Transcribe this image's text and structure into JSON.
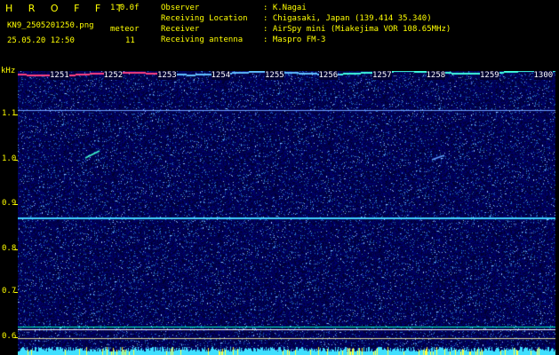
{
  "header": {
    "app_name": "H R O F F T",
    "version": "1.0.0f",
    "filename": "KN9_2505201250.png",
    "datetime": "25.05.20 12:50",
    "mode": "meteor",
    "count": "11",
    "observer_label": "Observer",
    "observer_value": ": K.Nagai",
    "location_label": "Receiving Location",
    "location_value": ": Chigasaki, Japan (139.414 35.340)",
    "receiver_label": "Receiver",
    "receiver_value": ": AirSpy mini (Miakejima VOR 108.65MHz)",
    "antenna_label": "Receiving antenna",
    "antenna_value": ": Maspro FM-3"
  },
  "axes": {
    "y_unit": "kHz",
    "y_ticks": [
      "1.1",
      "1.0",
      "0.9",
      "0.8",
      "0.7",
      "0.6"
    ],
    "x_ticks": [
      "1251",
      "1252",
      "1253",
      "1254",
      "1255",
      "1256",
      "1257",
      "1258",
      "1259",
      "1300"
    ]
  },
  "colors": {
    "text": "#ffff00",
    "background_low": "#000060",
    "carrier": "#3fd0ff"
  }
}
